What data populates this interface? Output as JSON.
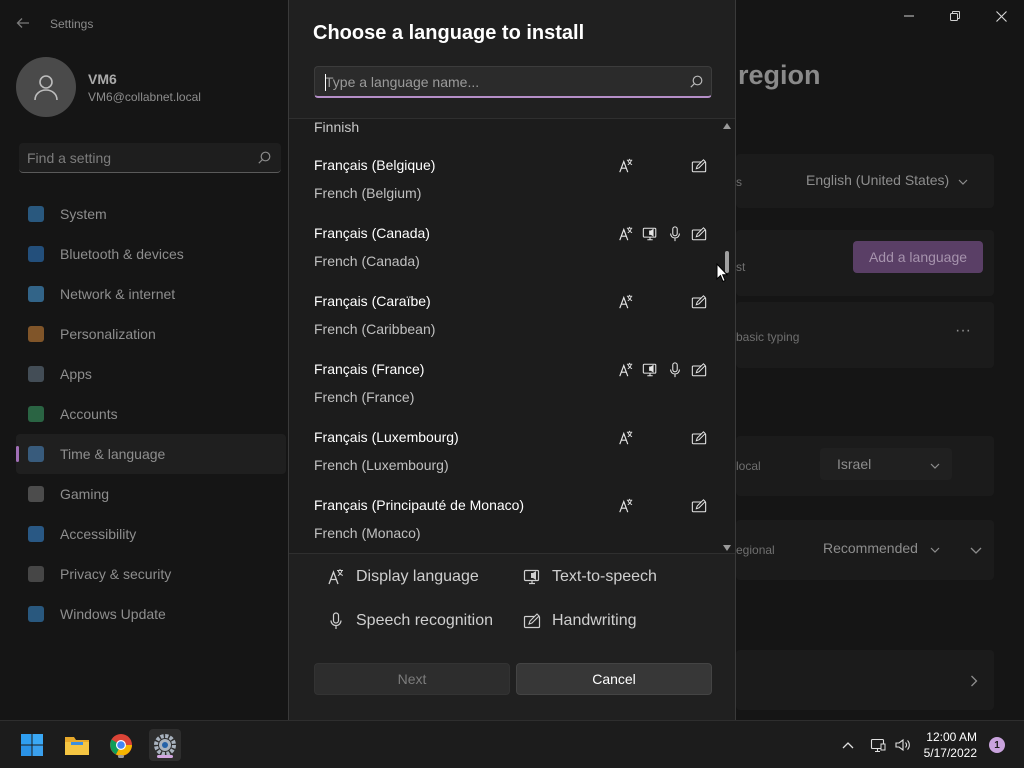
{
  "settings": {
    "app_title": "Settings",
    "profile": {
      "name": "VM6",
      "email": "VM6@collabnet.local"
    },
    "find_placeholder": "Find a setting",
    "nav": [
      {
        "label": "System",
        "color": "#3a8fd6"
      },
      {
        "label": "Bluetooth & devices",
        "color": "#2f7fd0"
      },
      {
        "label": "Network & internet",
        "color": "#4aa6e8"
      },
      {
        "label": "Personalization",
        "color": "#d98a3b"
      },
      {
        "label": "Apps",
        "color": "#6a7b8c"
      },
      {
        "label": "Accounts",
        "color": "#3ca66a"
      },
      {
        "label": "Time & language",
        "color": "#4c8cc8"
      },
      {
        "label": "Gaming",
        "color": "#7a7a7a"
      },
      {
        "label": "Accessibility",
        "color": "#3b8fe0"
      },
      {
        "label": "Privacy & security",
        "color": "#707070"
      },
      {
        "label": "Windows Update",
        "color": "#3a8fd6"
      }
    ],
    "active_nav": "Time & language",
    "right_panel": {
      "title_fragment": "region",
      "windows_display_language_suffix": "s",
      "display_language_value": "English (United States)",
      "preferred_suffix": "st",
      "add_language_label": "Add a language",
      "language_pack_text": "basic typing",
      "country_suffix": "local",
      "country_value": "Israel",
      "regional_suffix": "egional",
      "regional_value": "Recommended"
    }
  },
  "dialog": {
    "title": "Choose a language to install",
    "search_placeholder": "Type a language name...",
    "partial_item": "Finnish",
    "languages": [
      {
        "name": "Français (Belgique)",
        "english": "French (Belgium)",
        "features": [
          "display",
          "handwriting"
        ]
      },
      {
        "name": "Français (Canada)",
        "english": "French (Canada)",
        "features": [
          "display",
          "tts",
          "speech",
          "handwriting"
        ]
      },
      {
        "name": "Français (Caraïbe)",
        "english": "French (Caribbean)",
        "features": [
          "display",
          "handwriting"
        ]
      },
      {
        "name": "Français (France)",
        "english": "French (France)",
        "features": [
          "display",
          "tts",
          "speech",
          "handwriting"
        ]
      },
      {
        "name": "Français (Luxembourg)",
        "english": "French (Luxembourg)",
        "features": [
          "display",
          "handwriting"
        ]
      },
      {
        "name": "Français (Principauté de Monaco)",
        "english": "French (Monaco)",
        "features": [
          "display",
          "handwriting"
        ]
      }
    ],
    "legend": {
      "display": "Display language",
      "tts": "Text-to-speech",
      "speech": "Speech recognition",
      "handwriting": "Handwriting"
    },
    "next_label": "Next",
    "cancel_label": "Cancel"
  },
  "taskbar": {
    "apps": [
      "start-icon",
      "file-explorer-icon",
      "chrome-icon",
      "settings-icon"
    ],
    "time": "12:00 AM",
    "date": "5/17/2022",
    "notification_count": "1"
  }
}
